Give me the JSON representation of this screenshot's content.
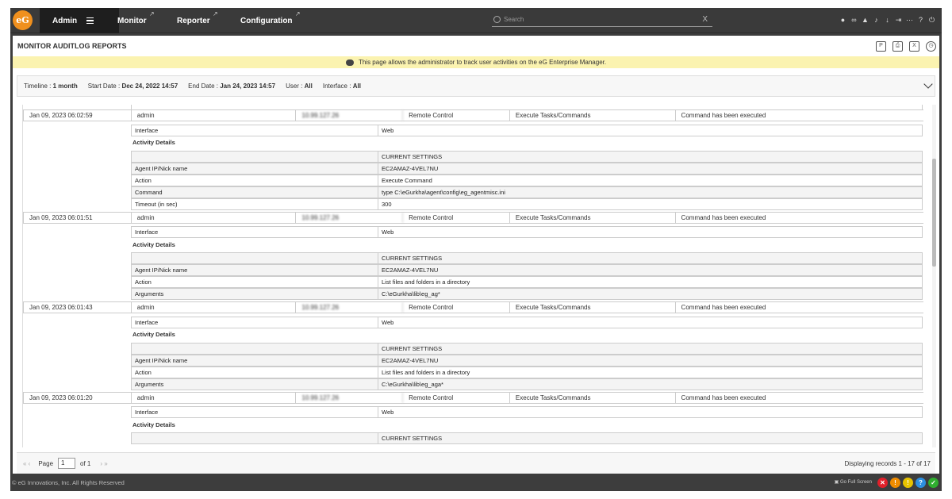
{
  "nav": {
    "logo": "eG",
    "tabs": [
      {
        "label": "Admin"
      },
      {
        "label": "Monitor"
      },
      {
        "label": "Reporter"
      },
      {
        "label": "Configuration"
      }
    ],
    "search_placeholder": "Search",
    "search_clear": "X"
  },
  "page": {
    "title": "MONITOR AUDITLOG REPORTS",
    "notice": "This page allows the administrator to track user activities on the eG Enterprise Manager."
  },
  "filters": {
    "timeline_label": "Timeline :",
    "timeline_value": "1 month",
    "start_label": "Start Date :",
    "start_value": "Dec 24, 2022 14:57",
    "end_label": "End Date :",
    "end_value": "Jan 24, 2023 14:57",
    "user_label": "User :",
    "user_value": "All",
    "interface_label": "Interface :",
    "interface_value": "All"
  },
  "records": [
    {
      "time": "Jan 09, 2023 06:02:59",
      "user": "admin",
      "ip": "10.99.127.26",
      "type": "Remote Control",
      "category": "Execute Tasks/Commands",
      "status": "Command has been executed",
      "interface_label": "Interface",
      "interface_value": "Web",
      "details_label": "Activity Details",
      "settings_label": "CURRENT SETTINGS",
      "settings": [
        {
          "k": "Agent IP/Nick name",
          "v": "EC2AMAZ-4VEL7NU"
        },
        {
          "k": "Action",
          "v": "Execute Command"
        },
        {
          "k": "Command",
          "v": "type C:\\eGurkha\\agent\\config\\eg_agentmisc.ini"
        },
        {
          "k": "Timeout (in sec)",
          "v": "300"
        }
      ]
    },
    {
      "time": "Jan 09, 2023 06:01:51",
      "user": "admin",
      "ip": "10.99.127.26",
      "type": "Remote Control",
      "category": "Execute Tasks/Commands",
      "status": "Command has been executed",
      "interface_label": "Interface",
      "interface_value": "Web",
      "details_label": "Activity Details",
      "settings_label": "CURRENT SETTINGS",
      "settings": [
        {
          "k": "Agent IP/Nick name",
          "v": "EC2AMAZ-4VEL7NU"
        },
        {
          "k": "Action",
          "v": "List files and folders in a directory"
        },
        {
          "k": "Arguments",
          "v": "C:\\eGurkha\\lib\\eg_ag*"
        }
      ]
    },
    {
      "time": "Jan 09, 2023 06:01:43",
      "user": "admin",
      "ip": "10.99.127.26",
      "type": "Remote Control",
      "category": "Execute Tasks/Commands",
      "status": "Command has been executed",
      "interface_label": "Interface",
      "interface_value": "Web",
      "details_label": "Activity Details",
      "settings_label": "CURRENT SETTINGS",
      "settings": [
        {
          "k": "Agent IP/Nick name",
          "v": "EC2AMAZ-4VEL7NU"
        },
        {
          "k": "Action",
          "v": "List files and folders in a directory"
        },
        {
          "k": "Arguments",
          "v": "C:\\eGurkha\\lib\\eg_aga*"
        }
      ]
    },
    {
      "time": "Jan 09, 2023 06:01:20",
      "user": "admin",
      "ip": "10.99.127.26",
      "type": "Remote Control",
      "category": "Execute Tasks/Commands",
      "status": "Command has been executed",
      "interface_label": "Interface",
      "interface_value": "Web",
      "details_label": "Activity Details",
      "settings_label": "CURRENT SETTINGS",
      "settings": []
    }
  ],
  "pager": {
    "page_label": "Page",
    "page_value": "1",
    "of_label": "of 1",
    "displaying": "Displaying records 1 - 17 of 17"
  },
  "footer": {
    "copyright": "© eG Innovations, Inc. All Rights Reserved",
    "fullscreen": "Go Full Screen"
  },
  "colors": {
    "nav_bg": "#3a3a3a",
    "accent": "#f0901e",
    "notice_bg": "#fbf3b0"
  }
}
